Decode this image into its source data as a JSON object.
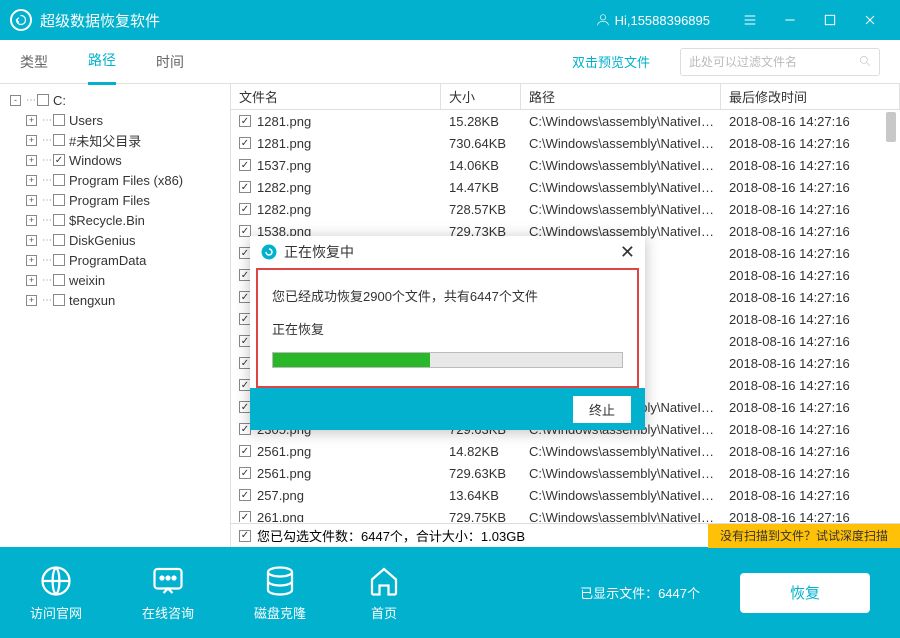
{
  "titlebar": {
    "title": "超级数据恢复软件",
    "user_prefix": "Hi,",
    "user_id": "15588396895"
  },
  "tabs": {
    "type": "类型",
    "path": "路径",
    "time": "时间",
    "preview_hint": "双击预览文件",
    "search_placeholder": "此处可以过滤文件名"
  },
  "tree": [
    {
      "indent": 0,
      "toggle": "-",
      "checked": false,
      "label": "C:"
    },
    {
      "indent": 1,
      "toggle": "+",
      "checked": false,
      "label": "Users"
    },
    {
      "indent": 1,
      "toggle": "+",
      "checked": false,
      "label": "#未知父目录"
    },
    {
      "indent": 1,
      "toggle": "+",
      "checked": true,
      "label": "Windows"
    },
    {
      "indent": 1,
      "toggle": "+",
      "checked": false,
      "label": "Program Files (x86)"
    },
    {
      "indent": 1,
      "toggle": "+",
      "checked": false,
      "label": "Program Files"
    },
    {
      "indent": 1,
      "toggle": "+",
      "checked": false,
      "label": "$Recycle.Bin"
    },
    {
      "indent": 1,
      "toggle": "+",
      "checked": false,
      "label": "DiskGenius"
    },
    {
      "indent": 1,
      "toggle": "+",
      "checked": false,
      "label": "ProgramData"
    },
    {
      "indent": 1,
      "toggle": "+",
      "checked": false,
      "label": "weixin"
    },
    {
      "indent": 1,
      "toggle": "+",
      "checked": false,
      "label": "tengxun"
    }
  ],
  "grid": {
    "headers": {
      "name": "文件名",
      "size": "大小",
      "path": "路径",
      "time": "最后修改时间"
    },
    "rows": [
      {
        "name": "1281.png",
        "size": "15.28KB",
        "path": "C:\\Windows\\assembly\\NativeIm...",
        "time": "2018-08-16 14:27:16"
      },
      {
        "name": "1281.png",
        "size": "730.64KB",
        "path": "C:\\Windows\\assembly\\NativeIm...",
        "time": "2018-08-16 14:27:16"
      },
      {
        "name": "1537.png",
        "size": "14.06KB",
        "path": "C:\\Windows\\assembly\\NativeIm...",
        "time": "2018-08-16 14:27:16"
      },
      {
        "name": "1282.png",
        "size": "14.47KB",
        "path": "C:\\Windows\\assembly\\NativeIm...",
        "time": "2018-08-16 14:27:16"
      },
      {
        "name": "1282.png",
        "size": "728.57KB",
        "path": "C:\\Windows\\assembly\\NativeIm...",
        "time": "2018-08-16 14:27:16"
      },
      {
        "name": "1538.png",
        "size": "729.73KB",
        "path": "C:\\Windows\\assembly\\NativeIm...",
        "time": "2018-08-16 14:27:16"
      },
      {
        "name": "",
        "size": "",
        "path": "nbly\\NativeIm...",
        "time": "2018-08-16 14:27:16"
      },
      {
        "name": "",
        "size": "",
        "path": "nbly\\NativeIm...",
        "time": "2018-08-16 14:27:16"
      },
      {
        "name": "",
        "size": "",
        "path": "nbly\\NativeIm...",
        "time": "2018-08-16 14:27:16"
      },
      {
        "name": "",
        "size": "",
        "path": "nbly\\NativeIm...",
        "time": "2018-08-16 14:27:16"
      },
      {
        "name": "",
        "size": "",
        "path": "nbly\\NativeIm...",
        "time": "2018-08-16 14:27:16"
      },
      {
        "name": "",
        "size": "",
        "path": "nbly\\NativeIm...",
        "time": "2018-08-16 14:27:16"
      },
      {
        "name": "",
        "size": "",
        "path": "nbly\\NativeIm...",
        "time": "2018-08-16 14:27:16"
      },
      {
        "name": "2305.png",
        "size": "13.7KB",
        "path": "C:\\Windows\\assembly\\NativeIm...",
        "time": "2018-08-16 14:27:16"
      },
      {
        "name": "2305.png",
        "size": "729.63KB",
        "path": "C:\\Windows\\assembly\\NativeIm...",
        "time": "2018-08-16 14:27:16"
      },
      {
        "name": "2561.png",
        "size": "14.82KB",
        "path": "C:\\Windows\\assembly\\NativeIm...",
        "time": "2018-08-16 14:27:16"
      },
      {
        "name": "2561.png",
        "size": "729.63KB",
        "path": "C:\\Windows\\assembly\\NativeIm...",
        "time": "2018-08-16 14:27:16"
      },
      {
        "name": "257.png",
        "size": "13.64KB",
        "path": "C:\\Windows\\assembly\\NativeIm...",
        "time": "2018-08-16 14:27:16"
      },
      {
        "name": "261.png",
        "size": "729.75KB",
        "path": "C:\\Windows\\assembly\\NativeIm...",
        "time": "2018-08-16 14:27:16"
      }
    ],
    "summary": "您已勾选文件数：6447个，合计大小：1.03GB",
    "deep_scan": "没有扫描到文件？试试深度扫描"
  },
  "dialog": {
    "title": "正在恢复中",
    "line1": "您已经成功恢复2900个文件，共有6447个文件",
    "line2": "正在恢复",
    "progress_pct": 45,
    "stop": "终止"
  },
  "bottombar": {
    "website": "访问官网",
    "consult": "在线咨询",
    "clone": "磁盘克隆",
    "home": "首页",
    "status": "已显示文件：6447个",
    "recover": "恢复"
  }
}
